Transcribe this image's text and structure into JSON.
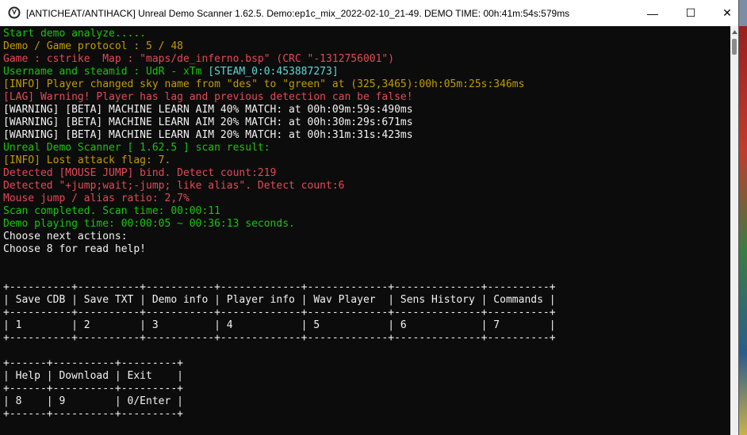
{
  "window": {
    "title": "[ANTICHEAT/ANTIHACK] Unreal Demo Scanner 1.62.5. Demo:ep1c_mix_2022-02-10_21-49. DEMO TIME: 00h:41m:54s:579ms",
    "controls": {
      "minimize": "—",
      "maximize": "☐",
      "close": "✕"
    }
  },
  "colors": {
    "green": "#16c60c",
    "orange": "#c19c00",
    "red": "#e74856",
    "teal": "#61d6d6",
    "white": "#f2f2f2",
    "light": "#cccccc",
    "string": "#ef9f9f"
  },
  "console": {
    "lines": [
      {
        "segments": [
          {
            "text": "Start demo analyze.....",
            "color": "green"
          }
        ]
      },
      {
        "segments": [
          {
            "text": "Demo / Game protocol : 5 / 48",
            "color": "orange"
          }
        ]
      },
      {
        "segments": [
          {
            "text": "Game : cstrike  Map : \"maps/de_inferno.bsp\" (CRC \"-1312756001\")",
            "color": "red"
          }
        ]
      },
      {
        "segments": [
          {
            "text": "Username and steamid : UdR - xTm ",
            "color": "green"
          },
          {
            "text": "[STEAM_0:0:453887273]",
            "color": "teal"
          }
        ]
      },
      {
        "segments": [
          {
            "text": "[INFO] Player changed sky name from \"des\" to \"green\" at (325,3465):00h:05m:25s:346ms",
            "color": "orange"
          }
        ]
      },
      {
        "segments": [
          {
            "text": "[LAG] Warning! Player has lag and previous detection can be false!",
            "color": "red"
          }
        ]
      },
      {
        "segments": [
          {
            "text": "[WARNING] [BETA] MACHINE LEARN AIM 40% MATCH: at 00h:09m:59s:490ms",
            "color": "white"
          }
        ]
      },
      {
        "segments": [
          {
            "text": "[WARNING] [BETA] MACHINE LEARN AIM 20% MATCH: at 00h:30m:29s:671ms",
            "color": "white"
          }
        ]
      },
      {
        "segments": [
          {
            "text": "[WARNING] [BETA] MACHINE LEARN AIM 20% MATCH: at 00h:31m:31s:423ms",
            "color": "white"
          }
        ]
      },
      {
        "segments": [
          {
            "text": "Unreal Demo Scanner [ 1.62.5 ] scan result:",
            "color": "green"
          }
        ]
      },
      {
        "segments": [
          {
            "text": "[INFO] Lost attack flag: 7.",
            "color": "orange"
          }
        ]
      },
      {
        "segments": [
          {
            "text": "Detected [MOUSE JUMP] bind. Detect count:219",
            "color": "red"
          }
        ]
      },
      {
        "segments": [
          {
            "text": "Detected \"+jump;wait;-jump; like alias\". Detect count:6",
            "color": "red"
          }
        ]
      },
      {
        "segments": [
          {
            "text": "Mouse jump / alias ratio: 2,7%",
            "color": "red"
          }
        ]
      },
      {
        "segments": [
          {
            "text": "Scan completed. Scan time: 00:00:11",
            "color": "green"
          }
        ]
      },
      {
        "segments": [
          {
            "text": "Demo playing time: 00:00:05 ~ 00:36:13 seconds.",
            "color": "green"
          }
        ]
      },
      {
        "segments": [
          {
            "text": "Choose next actions:",
            "color": "white"
          }
        ]
      },
      {
        "segments": [
          {
            "text": "Choose 8 for read help!",
            "color": "white"
          }
        ]
      },
      {
        "segments": []
      },
      {
        "segments": []
      },
      {
        "segments": [
          {
            "text": "+----------+----------+-----------+-------------+-------------+--------------+----------+",
            "color": "white"
          }
        ]
      },
      {
        "segments": [
          {
            "text": "| Save CDB | Save TXT | Demo info | Player info | Wav Player  | Sens History | Commands |",
            "color": "white"
          }
        ]
      },
      {
        "segments": [
          {
            "text": "+----------+----------+-----------+-------------+-------------+--------------+----------+",
            "color": "white"
          }
        ]
      },
      {
        "segments": [
          {
            "text": "| 1        | 2        | 3         | 4           | 5           | 6            | 7        |",
            "color": "white"
          }
        ]
      },
      {
        "segments": [
          {
            "text": "+----------+----------+-----------+-------------+-------------+--------------+----------+",
            "color": "white"
          }
        ]
      },
      {
        "segments": []
      },
      {
        "segments": [
          {
            "text": "+------+----------+---------+",
            "color": "white"
          }
        ]
      },
      {
        "segments": [
          {
            "text": "| Help | Download | Exit    |",
            "color": "white"
          }
        ]
      },
      {
        "segments": [
          {
            "text": "+------+----------+---------+",
            "color": "white"
          }
        ]
      },
      {
        "segments": [
          {
            "text": "| 8    | 9        | 0/Enter |",
            "color": "white"
          }
        ]
      },
      {
        "segments": [
          {
            "text": "+------+----------+---------+",
            "color": "white"
          }
        ]
      }
    ]
  }
}
